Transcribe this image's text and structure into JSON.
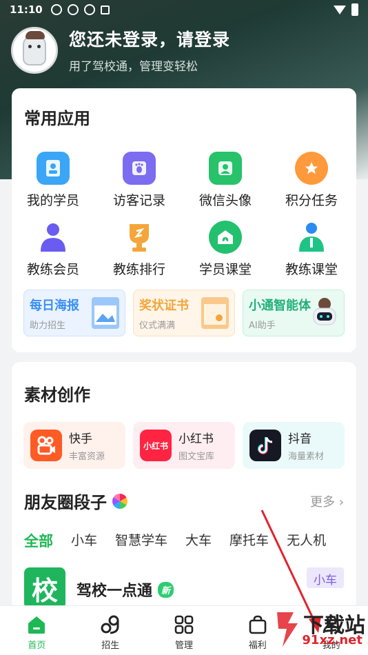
{
  "status": {
    "time": "11:10"
  },
  "profile": {
    "title": "您还未登录，请登录",
    "subtitle": "用了驾校通，管理变轻松"
  },
  "common_apps": {
    "title": "常用应用",
    "items": [
      {
        "label": "我的学员",
        "icon": "student-card-icon",
        "color": "#3aa6f5"
      },
      {
        "label": "访客记录",
        "icon": "footprint-icon",
        "color": "#7b6cf0"
      },
      {
        "label": "微信头像",
        "icon": "avatar-icon",
        "color": "#27c26a"
      },
      {
        "label": "积分任务",
        "icon": "star-badge-icon",
        "color": "#ff9a3c"
      },
      {
        "label": "教练会员",
        "icon": "coach-vip-icon",
        "color": "#6a5cf0"
      },
      {
        "label": "教练排行",
        "icon": "trophy-icon",
        "color": "#f4a63a"
      },
      {
        "label": "学员课堂",
        "icon": "classroom-icon",
        "color": "#23c06d"
      },
      {
        "label": "教练课堂",
        "icon": "coach-class-icon",
        "color": "#1ec486"
      }
    ],
    "promos": [
      {
        "title": "每日海报",
        "sub": "助力招生",
        "color": "#3a8ef6",
        "bg": "#eaf3ff"
      },
      {
        "title": "奖状证书",
        "sub": "仪式满满",
        "color": "#f4a53a",
        "bg": "#fff5e8"
      },
      {
        "title": "小通智能体",
        "sub": "AI助手",
        "color": "#20b07a",
        "bg": "#e9faf2"
      }
    ]
  },
  "materials": {
    "title": "素材创作",
    "items": [
      {
        "title": "快手",
        "sub": "丰富资源",
        "bg": "#fff1ec",
        "icon_bg": "#ff5b25",
        "icon": "kuaishou-icon"
      },
      {
        "title": "小红书",
        "sub": "图文宝库",
        "bg": "#ffeef1",
        "icon_bg": "#ff2442",
        "icon_text": "小红书"
      },
      {
        "title": "抖音",
        "sub": "海量素材",
        "bg": "#eafafb",
        "icon_bg": "#161823",
        "icon": "douyin-icon"
      }
    ],
    "moments": {
      "title": "朋友圈段子",
      "more": "更多",
      "filters": [
        "全部",
        "小车",
        "智慧学车",
        "大车",
        "摩托车",
        "无人机"
      ]
    },
    "article": {
      "icon_text": "校",
      "title": "驾校一点通",
      "badge": "新",
      "tag": "小车"
    }
  },
  "tabbar": [
    {
      "label": "首页",
      "icon": "home-icon"
    },
    {
      "label": "招生",
      "icon": "recruit-icon"
    },
    {
      "label": "管理",
      "icon": "grid-icon"
    },
    {
      "label": "福利",
      "icon": "gift-bag-icon"
    },
    {
      "label": "我的",
      "icon": "profile-icon"
    }
  ],
  "watermark": {
    "text1": "下载站",
    "text2": "91xz.net"
  },
  "colors": {
    "accent": "#1db954",
    "arrow": "#e0242c"
  }
}
